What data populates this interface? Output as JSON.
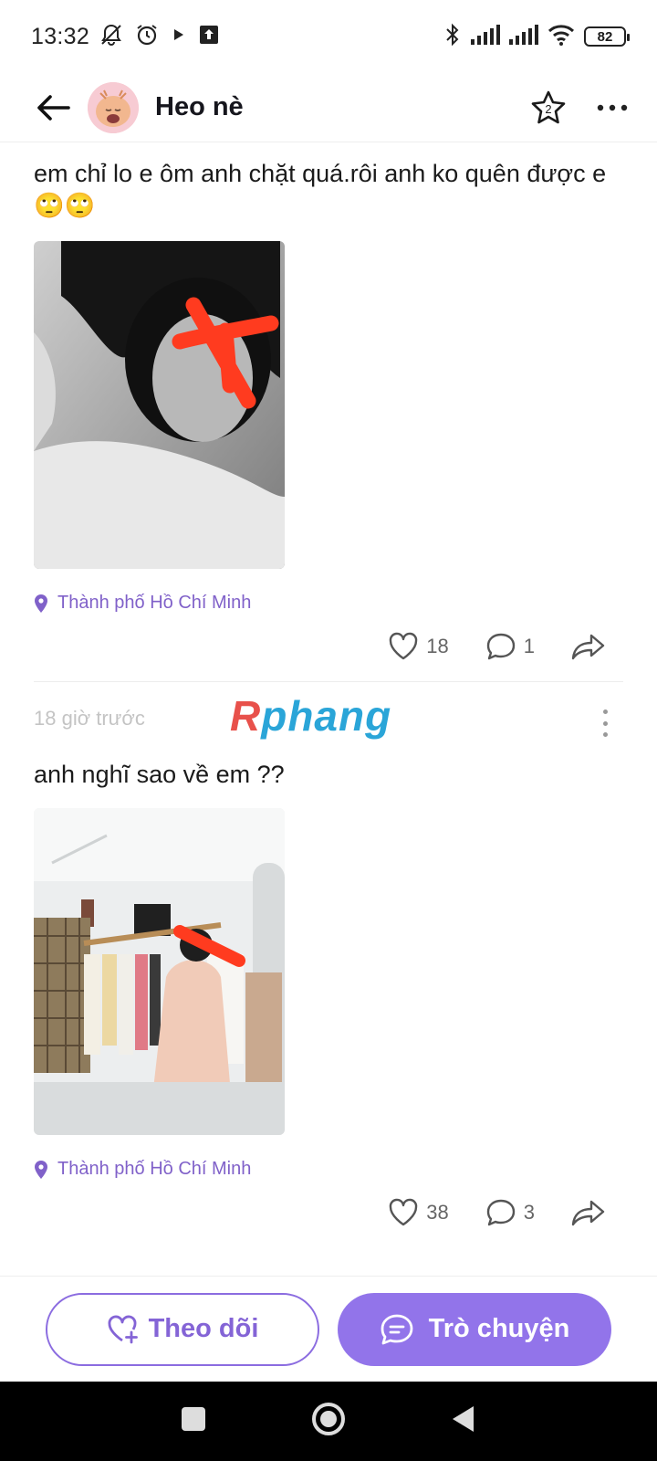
{
  "status_bar": {
    "time": "13:32",
    "battery": "82"
  },
  "header": {
    "title": "Heo nè",
    "star_count": "2"
  },
  "posts": [
    {
      "text": "em chỉ lo e ôm anh chặt quá.rôi anh ko quên được e🙄🙄",
      "location": "Thành phố Hồ Chí Minh",
      "likes": "18",
      "comments": "1"
    },
    {
      "timestamp": "18 giờ trước",
      "text": "anh nghĩ sao về em ??",
      "location": "Thành phố Hồ Chí Minh",
      "likes": "38",
      "comments": "3"
    }
  ],
  "watermark": {
    "first": "R",
    "rest": "phang"
  },
  "bottom": {
    "follow_label": "Theo dõi",
    "chat_label": "Trò chuyện"
  },
  "colors": {
    "accent": "#9274ea",
    "location": "#8061c9",
    "redaction": "#ff3b1f"
  }
}
